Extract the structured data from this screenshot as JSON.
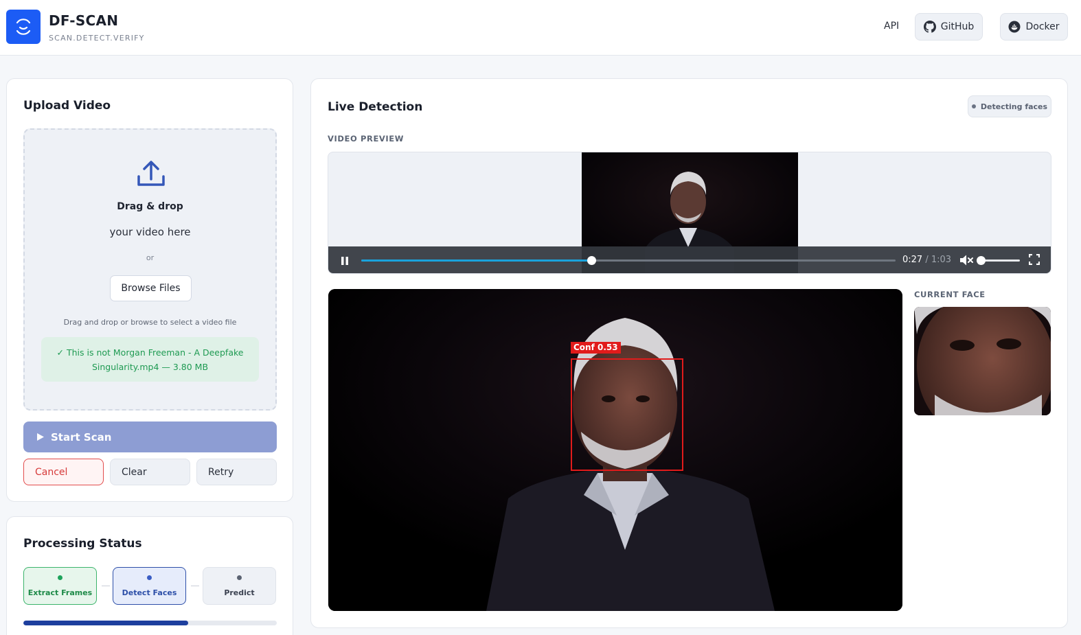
{
  "header": {
    "title": "DF-SCAN",
    "subtitle": "SCAN.DETECT.VERIFY",
    "nav": {
      "api": "API",
      "github": "GitHub",
      "docker": "Docker"
    }
  },
  "upload": {
    "title": "Upload Video",
    "drop_title": "Drag & drop",
    "drop_sub": "your video here",
    "or": "or",
    "browse": "Browse Files",
    "hint": "Drag and drop or browse to select a video file",
    "file_status": "✓ This is not Morgan Freeman - A Deepfake Singularity.mp4 — 3.80 MB",
    "start": "Start Scan",
    "cancel": "Cancel",
    "clear": "Clear",
    "retry": "Retry"
  },
  "status": {
    "title": "Processing Status",
    "steps": [
      {
        "label": "Extract Frames",
        "state": "done"
      },
      {
        "label": "Detect Faces",
        "state": "active"
      },
      {
        "label": "Predict",
        "state": "pending"
      }
    ],
    "progress": 0.65
  },
  "live": {
    "title": "Live Detection",
    "badge": "Detecting faces",
    "preview_label": "VIDEO PREVIEW",
    "player": {
      "current": "0:27",
      "separator": " / ",
      "duration": "1:03",
      "progress": 0.43,
      "muted": true,
      "volume": 0.0
    },
    "detection_label": "Conf 0.53",
    "current_face_label": "CURRENT FACE"
  },
  "colors": {
    "brand": "#1c5cf5",
    "success": "#1e9a52",
    "danger": "#d63a3a",
    "detect": "#2d4fa8",
    "bbox": "#e11b1b",
    "seek": "#1aa3dd"
  },
  "icons": [
    "scan-logo-icon",
    "github-icon",
    "docker-icon",
    "upload-icon",
    "play-icon",
    "pause-icon",
    "mute-icon",
    "fullscreen-icon"
  ]
}
